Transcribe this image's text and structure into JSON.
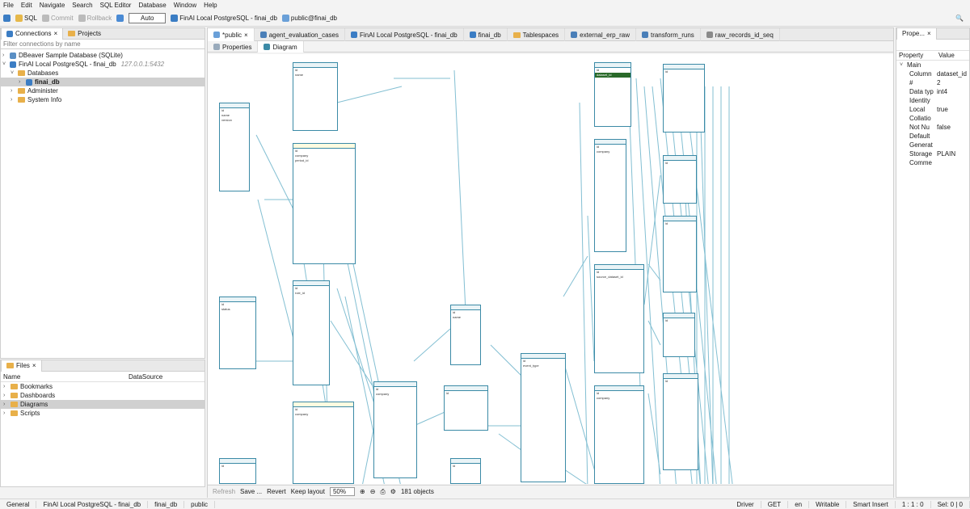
{
  "menu": [
    "File",
    "Edit",
    "Navigate",
    "Search",
    "SQL Editor",
    "Database",
    "Window",
    "Help"
  ],
  "toolbar": {
    "sql": "SQL",
    "commit": "Commit",
    "rollback": "Rollback",
    "auto": "Auto",
    "connection": "FinAI Local PostgreSQL - finai_db",
    "schema": "public@finai_db"
  },
  "nav": {
    "tab_connections": "Connections",
    "tab_projects": "Projects",
    "filter_placeholder": "Filter connections by name",
    "items": [
      {
        "label": "DBeaver Sample Database (SQLite)"
      },
      {
        "label": "FinAI Local PostgreSQL - finai_db",
        "detail": "127.0.0.1:5432"
      },
      {
        "label": "Databases"
      },
      {
        "label": "finai_db"
      },
      {
        "label": "Administer"
      },
      {
        "label": "System Info"
      }
    ]
  },
  "files": {
    "tab": "Files",
    "col_name": "Name",
    "col_ds": "DataSource",
    "items": [
      "Bookmarks",
      "Dashboards",
      "Diagrams",
      "Scripts"
    ]
  },
  "editor_tabs": [
    "*public",
    "agent_evaluation_cases",
    "FinAI Local PostgreSQL - finai_db",
    "finai_db",
    "Tablespaces",
    "external_erp_raw",
    "transform_runs",
    "raw_records_id_seq"
  ],
  "sub_tabs": [
    "Properties",
    "Diagram"
  ],
  "diagram_bottom": {
    "refresh": "Refresh",
    "save": "Save ...",
    "revert": "Revert",
    "keep_layout": "Keep layout",
    "zoom": "50%",
    "objects": "181 objects"
  },
  "properties": {
    "tab": "Prope...",
    "col_property": "Property",
    "col_value": "Value",
    "group": "Main",
    "rows": [
      {
        "k": "Column",
        "v": "dataset_id"
      },
      {
        "k": "#",
        "v": "2"
      },
      {
        "k": "Data typ",
        "v": "int4"
      },
      {
        "k": "Identity",
        "v": ""
      },
      {
        "k": "Local",
        "v": "true"
      },
      {
        "k": "Collatio",
        "v": ""
      },
      {
        "k": "Not Nu",
        "v": "false"
      },
      {
        "k": "Default",
        "v": ""
      },
      {
        "k": "Generat",
        "v": ""
      },
      {
        "k": "Storage",
        "v": "PLAIN"
      },
      {
        "k": "Comme",
        "v": ""
      }
    ]
  },
  "status": {
    "general": "General",
    "path": [
      "FinAI Local PostgreSQL - finai_db",
      "finai_db",
      "public"
    ],
    "driver": "Driver",
    "get": "GET",
    "lang": "en",
    "writable": "Writable",
    "insert": "Smart Insert",
    "pos": "1 : 1 : 0",
    "sel": "Sel: 0 | 0"
  }
}
